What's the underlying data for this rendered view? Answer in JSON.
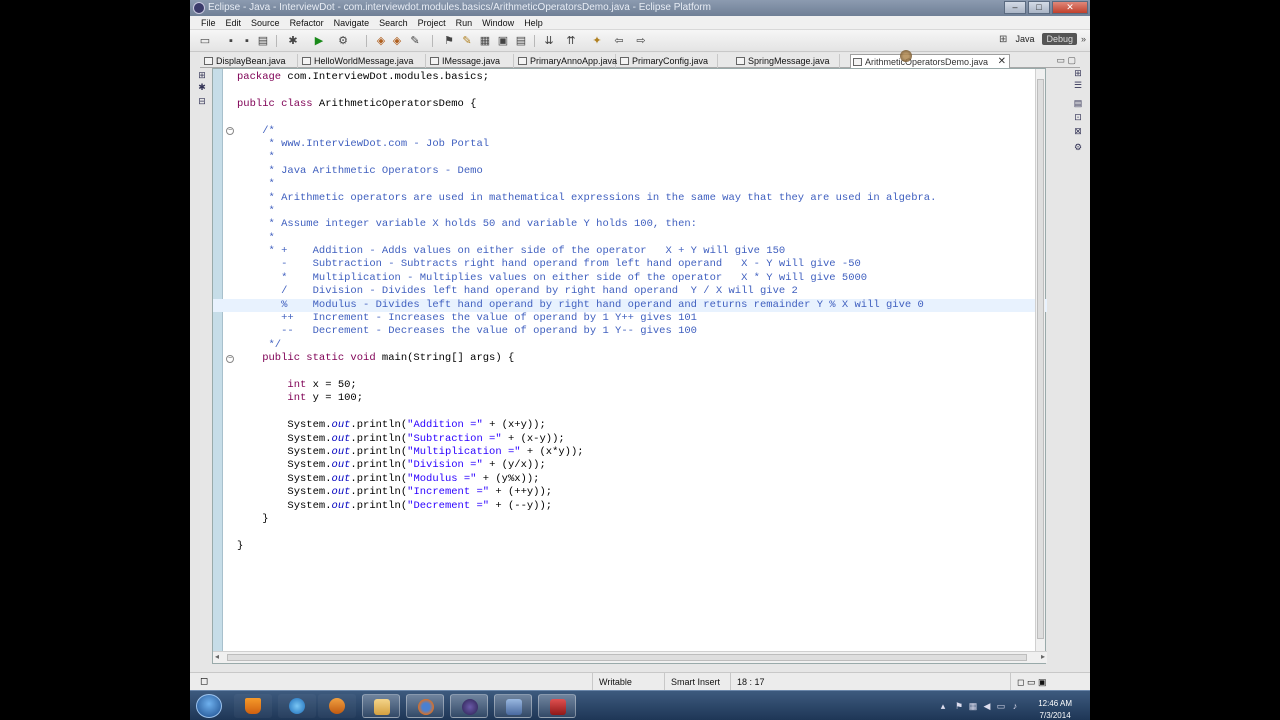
{
  "window": {
    "title": "Eclipse - Java - InterviewDot - com.interviewdot.modules.basics/ArithmeticOperatorsDemo.java - Eclipse Platform",
    "min_icon": "minimize-icon",
    "max_icon": "maximize-icon",
    "close_icon": "close-icon"
  },
  "menu": [
    "File",
    "Edit",
    "Source",
    "Refactor",
    "Navigate",
    "Search",
    "Project",
    "Run",
    "Window",
    "Help"
  ],
  "perspectives": {
    "java": "Java",
    "debug": "Debug"
  },
  "tabs": [
    {
      "label": "DisplayBean.java"
    },
    {
      "label": "HelloWorldMessage.java"
    },
    {
      "label": "IMessage.java"
    },
    {
      "label": "PrimaryAnnoApp.java"
    },
    {
      "label": "PrimaryConfig.java"
    },
    {
      "label": "SpringMessage.java"
    },
    {
      "label": "ArithmeticOperatorsDemo.java",
      "active": true
    }
  ],
  "code": {
    "l1_kw": "package",
    "l1_rest": " com.InterviewDot.modules.basics;",
    "l3_kw": "public class",
    "l3_rest": " ArithmeticOperatorsDemo {",
    "c1": "    /*",
    "c2": "     * www.InterviewDot.com - Job Portal",
    "c3": "     *",
    "c4": "     * Java Arithmetic Operators - Demo",
    "c5": "     *",
    "c6": "     * Arithmetic operators are used in mathematical expressions in the same way that they are used in algebra.",
    "c7": "     *",
    "c8": "     * Assume integer variable X holds 50 and variable Y holds 100, then:",
    "c9": "     *",
    "c10": "     * +    Addition - Adds values on either side of the operator   X + Y will give 150",
    "c11": "       -    Subtraction - Subtracts right hand operand from left hand operand   X - Y will give -50",
    "c12": "       *    Multiplication - Multiplies values on either side of the operator   X * Y will give 5000",
    "c13": "       /    Division - Divides left hand operand by right hand operand  Y / X will give 2",
    "c14": "       %    Modulus - Divides left hand operand by right hand operand and returns remainder Y % X will give 0",
    "c15": "       ++   Increment - Increases the value of operand by 1 Y++ gives 101",
    "c16": "       --   Decrement - Decreases the value of operand by 1 Y-- gives 100",
    "c17": "     */",
    "m_kw": "    public static void",
    "m_rest": " main(String[] args) {",
    "x_kw": "        int",
    "x_rest": " x = 50;",
    "y_kw": "        int",
    "y_rest": " y = 100;",
    "println": [
      {
        "pre": "        System.",
        "out": "out",
        "mid": ".println(",
        "str": "\"Addition =\"",
        "post": " + (x+y));"
      },
      {
        "pre": "        System.",
        "out": "out",
        "mid": ".println(",
        "str": "\"Subtraction =\"",
        "post": " + (x-y));"
      },
      {
        "pre": "        System.",
        "out": "out",
        "mid": ".println(",
        "str": "\"Multiplication =\"",
        "post": " + (x*y));"
      },
      {
        "pre": "        System.",
        "out": "out",
        "mid": ".println(",
        "str": "\"Division =\"",
        "post": " + (y/x));"
      },
      {
        "pre": "        System.",
        "out": "out",
        "mid": ".println(",
        "str": "\"Modulus =\"",
        "post": " + (y%x));"
      },
      {
        "pre": "        System.",
        "out": "out",
        "mid": ".println(",
        "str": "\"Increment =\"",
        "post": " + (++y));"
      },
      {
        "pre": "        System.",
        "out": "out",
        "mid": ".println(",
        "str": "\"Decrement =\"",
        "post": " + (--y));"
      }
    ],
    "close_method": "    }",
    "close_class": "}"
  },
  "status": {
    "writable": "Writable",
    "insert_mode": "Smart Insert",
    "position": "18 : 17"
  },
  "clock": {
    "time": "12:46 AM",
    "date": "7/3/2014"
  }
}
